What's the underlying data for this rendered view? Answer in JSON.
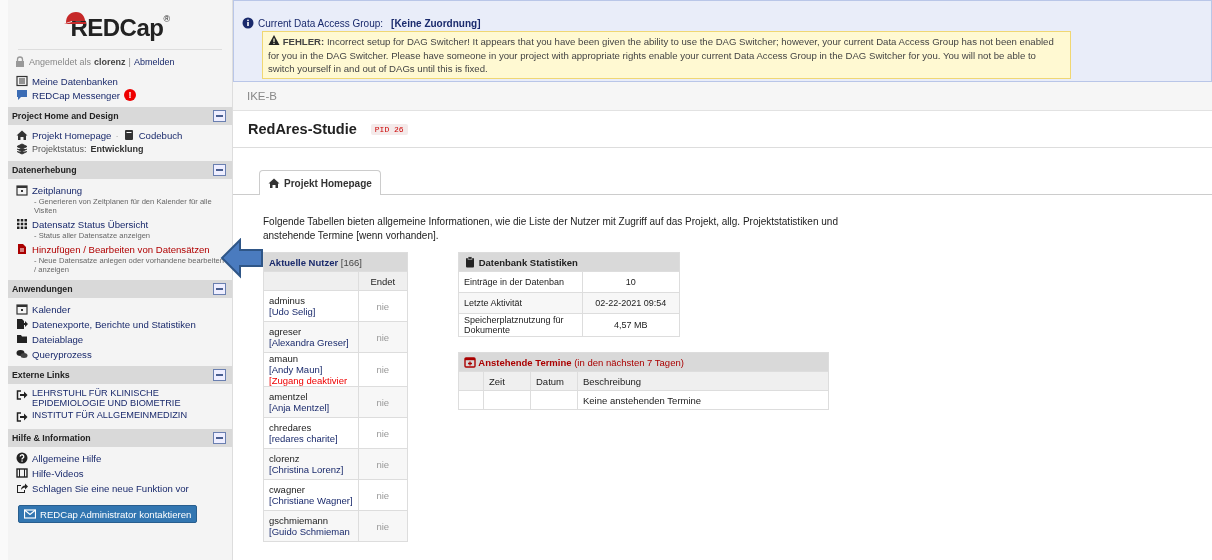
{
  "logo": {
    "text": "REDCap",
    "mark": "®"
  },
  "login": {
    "prefix": "Angemeldet als",
    "user": "clorenz",
    "separator": "|",
    "logout": "Abmelden"
  },
  "top_links": [
    {
      "label": "Meine Datenbanken"
    },
    {
      "label": "REDCap Messenger",
      "badge": "!"
    }
  ],
  "sections": [
    {
      "title": "Project Home and Design",
      "expanded": true,
      "items": [
        {
          "kind": "link-pair",
          "links": [
            {
              "label": "Projekt Homepage"
            },
            {
              "label": "Codebuch"
            }
          ],
          "separator": "·"
        },
        {
          "kind": "status",
          "label": "Projektstatus:",
          "value": "Entwicklung"
        }
      ]
    },
    {
      "title": "Datenerhebung",
      "expanded": true,
      "items": [
        {
          "kind": "link",
          "label": "Zeitplanung",
          "note": "- Generieren von Zeitplanen für den Kalender für alle Visiten"
        },
        {
          "kind": "link",
          "label": "Datensatz Status Übersicht",
          "note": "- Status aller Datensatze anzeigen"
        },
        {
          "kind": "accent-link",
          "label": "Hinzufügen / Bearbeiten von Datensätzen",
          "note": "- Neue Datensatze anlegen oder vorhandene bearbeiten / anzeigen"
        }
      ]
    },
    {
      "title": "Anwendungen",
      "expanded": true,
      "items": [
        {
          "kind": "link",
          "label": "Kalender"
        },
        {
          "kind": "link",
          "label": "Datenexporte, Berichte und Statistiken"
        },
        {
          "kind": "link",
          "label": "Dateiablage"
        },
        {
          "kind": "link",
          "label": "Queryprozess"
        }
      ]
    },
    {
      "title": "Externe Links",
      "expanded": true,
      "items": [
        {
          "kind": "external",
          "label": "LEHRSTUHL FÜR KLINISCHE EPIDEMIOLOGIE UND BIOMETRIE"
        },
        {
          "kind": "external",
          "label": "INSTITUT FÜR ALLGEMEINMEDIZIN"
        }
      ]
    },
    {
      "title": "Hilfe & Information",
      "expanded": true,
      "items": [
        {
          "kind": "link",
          "label": "Allgemeine Hilfe"
        },
        {
          "kind": "link",
          "label": "Hilfe-Videos"
        },
        {
          "kind": "link",
          "label": "Schlagen Sie eine neue Funktion vor"
        }
      ]
    }
  ],
  "contact_button": "REDCap Administrator kontaktieren",
  "dag": {
    "label": "Current Data Access Group:",
    "value": "[Keine Zuordnung]",
    "error_label": "FEHLER:",
    "error_text": "Incorrect setup for DAG Switcher! It appears that you have been given the ability to use the DAG Switcher; however, your current Data Access Group has not been enabled for you in the DAG Switcher. Please have someone in your project with appropriate rights enable your current Data Access Group in the DAG Switcher for you. You will not be able to switch yourself in and out of DAGs until this is fixed."
  },
  "breadcrumb": "IKE-B",
  "project": {
    "title": "RedAres-Studie",
    "pid": "PID 26"
  },
  "tabs": [
    {
      "label": "Projekt Homepage",
      "selected": true
    }
  ],
  "intro": "Folgende Tabellen bieten allgemeine Informationen, wie die Liste der Nutzer mit Zugriff auf das Projekt, allg. Projektstatistiken und anstehende Termine [wenn vorhanden].",
  "users_table": {
    "title": "Aktuelle Nutzer",
    "count": "[166]",
    "end_column": "Endet",
    "rows": [
      {
        "username": "adminus",
        "name": "[Udo Selig]",
        "ends": "nie"
      },
      {
        "username": "agreser",
        "name": "[Alexandra Greser]",
        "ends": "nie"
      },
      {
        "username": "amaun",
        "name": "[Andy Maun]",
        "note": "[Zugang deaktivier",
        "ends": "nie"
      },
      {
        "username": "amentzel",
        "name": "[Anja Mentzel]",
        "ends": "nie"
      },
      {
        "username": "chredares",
        "name": "[redares charite]",
        "ends": "nie"
      },
      {
        "username": "clorenz",
        "name": "[Christina Lorenz]",
        "ends": "nie"
      },
      {
        "username": "cwagner",
        "name": "[Christiane Wagner]",
        "ends": "nie"
      },
      {
        "username": "gschmiemann",
        "name": "[Guido Schmieman",
        "ends": "nie"
      }
    ]
  },
  "stats_table": {
    "title": "Datenbank Statistiken",
    "rows": [
      {
        "label": "Einträge in der Datenban",
        "value": "10"
      },
      {
        "label": "Letzte Aktivität",
        "value": "02-22-2021 09:54"
      },
      {
        "label": "Speicherplatznutzung für Dokumente",
        "value": "4,57 MB"
      }
    ]
  },
  "events_table": {
    "title": "Anstehende Termine",
    "subtitle": "(in den nächsten 7 Tagen)",
    "columns": [
      "Zeit",
      "Datum",
      "Beschreibung"
    ],
    "empty_message": "Keine anstehenden Termine"
  }
}
